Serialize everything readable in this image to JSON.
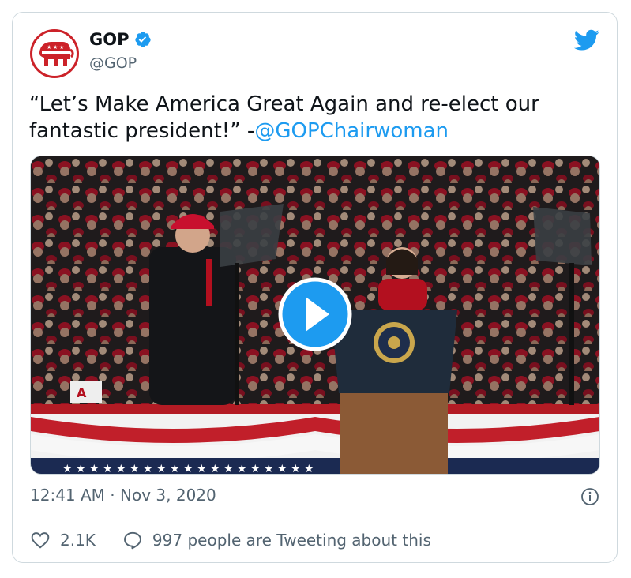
{
  "tweet": {
    "display_name": "GOP",
    "handle": "@GOP",
    "text_part1": "“Let’s Make America Great Again and re-elect our fantastic president!” -",
    "mention": "@GOPChairwoman",
    "time": "12:41 AM",
    "separator": "·",
    "date": "Nov 3, 2020",
    "like_count": "2.1K",
    "tweeting_text": "997 people are Tweeting about this"
  },
  "media": {
    "type": "video",
    "play_icon": "play-icon",
    "podium_letter": "A"
  },
  "icons": {
    "verified": "verified-badge-icon",
    "logo": "twitter-bird-icon",
    "avatar": "republican-elephant-logo",
    "info": "info-icon",
    "like": "heart-icon",
    "reply": "speech-bubble-icon"
  },
  "colors": {
    "accent": "#1d9bf0",
    "text_secondary": "#536471",
    "gop_red": "#cc2229",
    "border": "#cfd9de"
  }
}
